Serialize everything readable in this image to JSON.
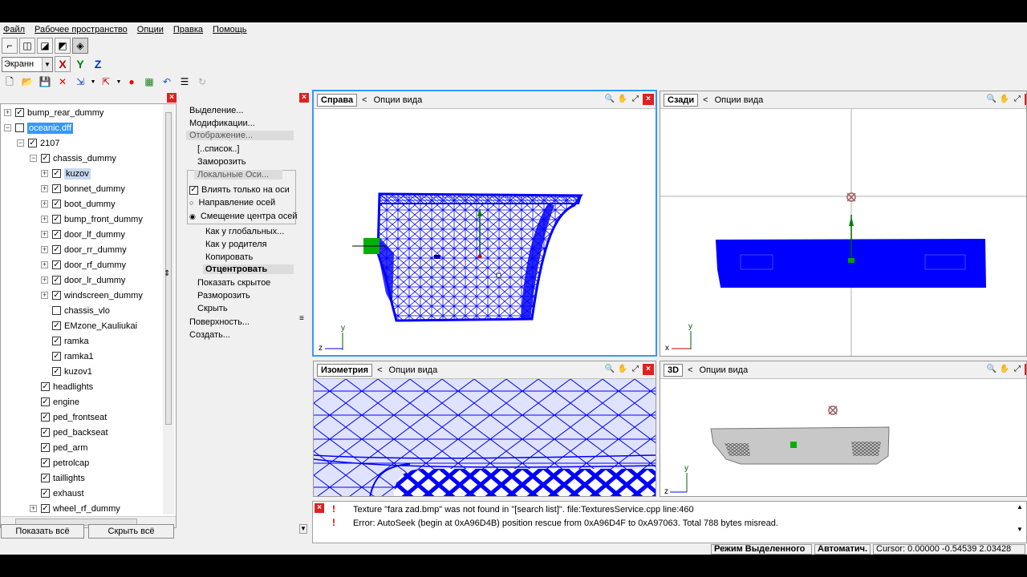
{
  "menu": [
    "Файл",
    "Рабочее пространство",
    "Опции",
    "Правка",
    "Помощь"
  ],
  "toolbar": {
    "space_select": "Экранн",
    "axes": [
      "X",
      "Y",
      "Z"
    ]
  },
  "tree": {
    "items": [
      {
        "label": "bump_rear_dummy",
        "checked": true
      },
      {
        "label": "oceanic.dff",
        "checked": false
      },
      {
        "label": "2107",
        "checked": true
      },
      {
        "label": "chassis_dummy",
        "checked": true
      },
      {
        "label": "kuzov",
        "checked": true
      },
      {
        "label": "bonnet_dummy",
        "checked": true
      },
      {
        "label": "boot_dummy",
        "checked": true
      },
      {
        "label": "bump_front_dummy",
        "checked": true
      },
      {
        "label": "door_lf_dummy",
        "checked": true
      },
      {
        "label": "door_rr_dummy",
        "checked": true
      },
      {
        "label": "door_rf_dummy",
        "checked": true
      },
      {
        "label": "door_lr_dummy",
        "checked": true
      },
      {
        "label": "windscreen_dummy",
        "checked": true
      },
      {
        "label": "chassis_vlo",
        "checked": false
      },
      {
        "label": "EMzone_Kauliukai",
        "checked": true
      },
      {
        "label": "ramka",
        "checked": true
      },
      {
        "label": "ramka1",
        "checked": true
      },
      {
        "label": "kuzov1",
        "checked": true
      },
      {
        "label": "headlights",
        "checked": true
      },
      {
        "label": "engine",
        "checked": true
      },
      {
        "label": "ped_frontseat",
        "checked": true
      },
      {
        "label": "ped_backseat",
        "checked": true
      },
      {
        "label": "ped_arm",
        "checked": true
      },
      {
        "label": "petrolcap",
        "checked": true
      },
      {
        "label": "taillights",
        "checked": true
      },
      {
        "label": "exhaust",
        "checked": true
      },
      {
        "label": "wheel_rf_dummy",
        "checked": true
      }
    ],
    "show_all": "Показать всё",
    "hide_all": "Скрыть всё"
  },
  "props": {
    "selection": "Выделение...",
    "modifications": "Модификации...",
    "display": "Отображение...",
    "list": "[..список..]",
    "freeze": "Заморозить",
    "local_axes": "Локальные Оси...",
    "affect_axes_only": "Влиять только на оси",
    "axes_direction": "Направление осей",
    "pivot_offset": "Смещение центра осей",
    "as_global": "Как у глобальных...",
    "as_parent": "Как у родителя",
    "copy": "Копировать",
    "center": "Отцентровать",
    "show_hidden": "Показать скрытое",
    "unfreeze": "Разморозить",
    "hide": "Скрыть",
    "surface": "Поверхность...",
    "create": "Создать..."
  },
  "viewports": {
    "right": {
      "title": "Справа",
      "options": "Опции вида"
    },
    "back": {
      "title": "Сзади",
      "options": "Опции вида"
    },
    "iso": {
      "title": "Изометрия",
      "options": "Опции вида"
    },
    "view3d": {
      "title": "3D",
      "options": "Опции вида"
    }
  },
  "log": [
    "Texture \"fara zad.bmp\" was not found in \"[search list]\". file:TexturesService.cpp line:460",
    "Error: AutoSeek (begin at 0xA96D4B) position rescue  from 0xA96D4F to 0xA97063. Total 788 bytes misread."
  ],
  "status": {
    "mode": "Режим Выделенного",
    "auto": "Автоматич.",
    "cursor": "Cursor: 0.00000  -0.54539  2.03428"
  },
  "axis_labels": {
    "y": "y",
    "z": "z",
    "x": "x"
  },
  "colors": {
    "mesh": "#0000ff",
    "accent": "#3399ff",
    "close": "#dd2222"
  }
}
